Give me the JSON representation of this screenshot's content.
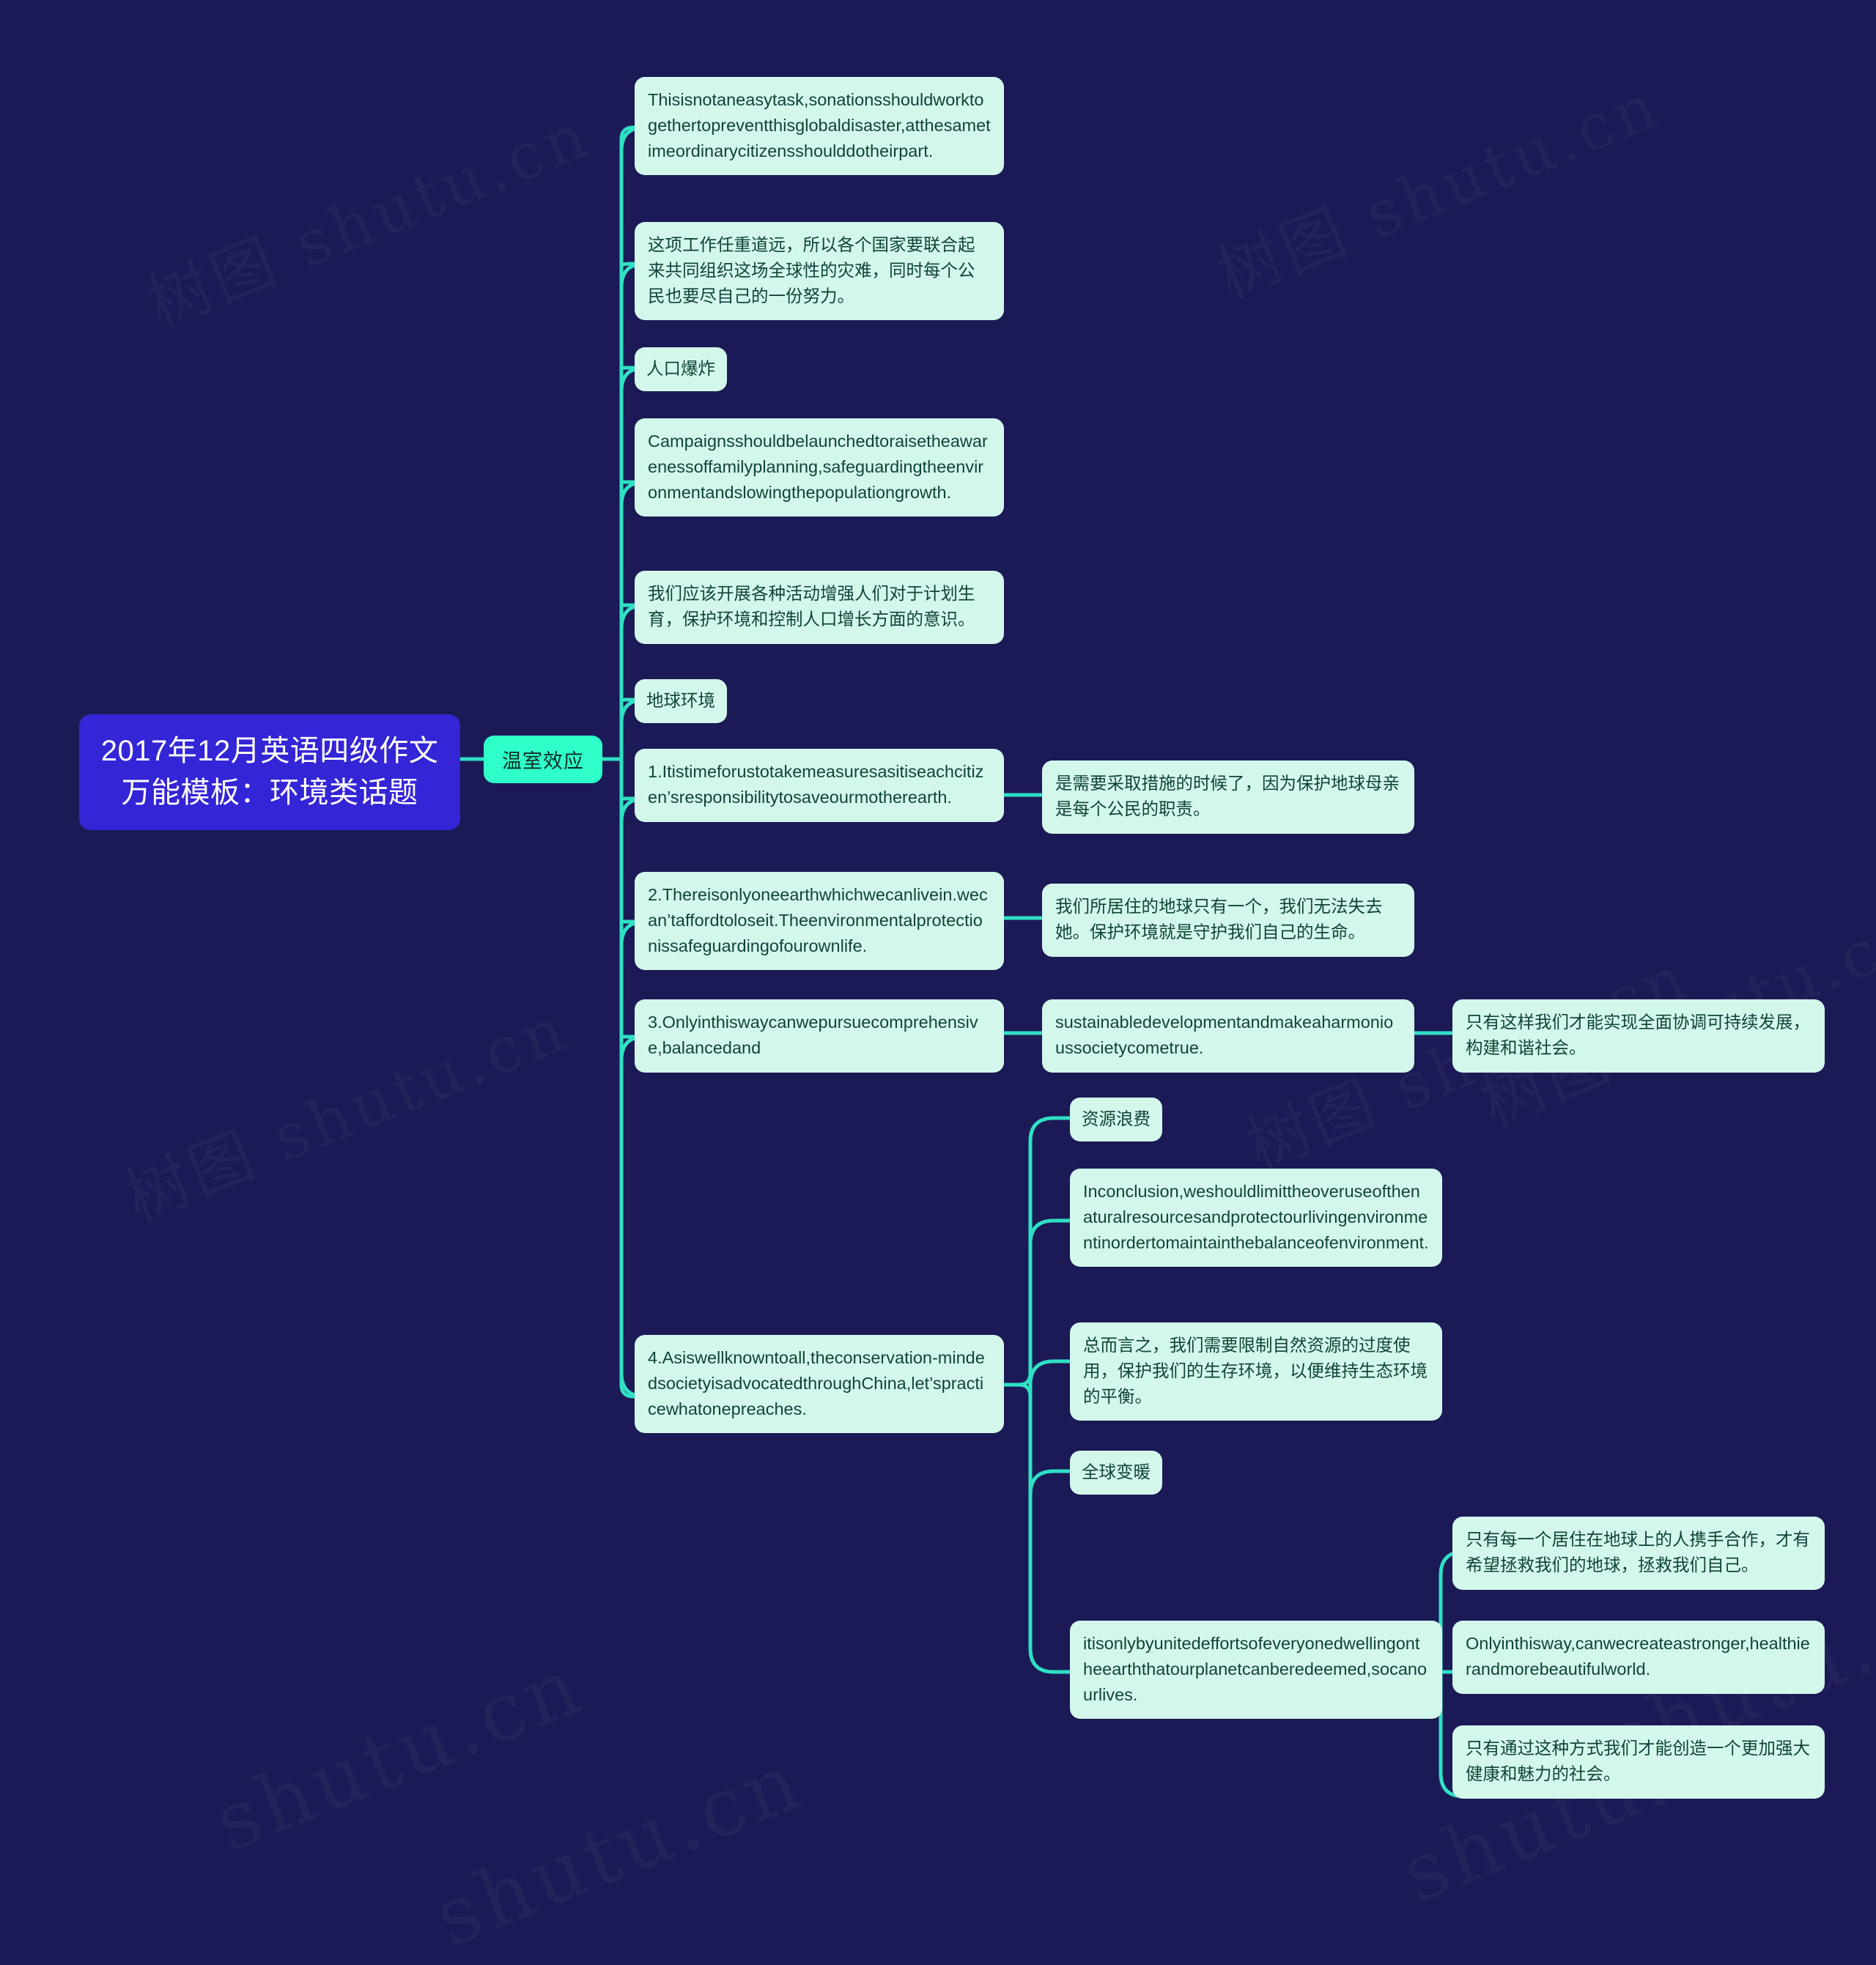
{
  "meta": {
    "background_color": "#1b1a56",
    "root_color": "#3425d6",
    "branch_color": "#2fffc8",
    "node_color": "#d4f7ec",
    "link_color": "#2fe0c4",
    "text_color": "#10443a"
  },
  "watermark": {
    "text": "树图 shutu.cn",
    "text_alt": "shutu.cn"
  },
  "root": {
    "label": "2017年12月英语四级作文万能模板：环境类话题"
  },
  "branch": {
    "label": "温室效应"
  },
  "nodes": {
    "n1": "Thisisnotaneasytask,sonationsshouldworktogethertopreventthisglobaldisaster,atthesametimeordinarycitizensshoulddotheirpart.",
    "n2": "这项工作任重道远，所以各个国家要联合起来共同组织这场全球性的灾难，同时每个公民也要尽自己的一份努力。",
    "n3": "人口爆炸",
    "n4": "Campaignsshouldbelaunchedtoraisetheawarenessoffamilyplanning,safeguardingtheenvironmentandslowingthepopulationgrowth.",
    "n5": "我们应该开展各种活动增强人们对于计划生育，保护环境和控制人口增长方面的意识。",
    "n6": "地球环境",
    "n7": "1.Itistimeforustotakemeasuresasitiseachcitizen’sresponsibilitytosaveourmotherearth.",
    "n7b": "是需要采取措施的时候了，因为保护地球母亲是每个公民的职责。",
    "n8": "2.Thereisonlyoneearthwhichwecanlivein.wecan’taffordtoloseit.Theenvironmentalprotectionissafeguardingofourownlife.",
    "n8b": "我们所居住的地球只有一个，我们无法失去她。保护环境就是守护我们自己的生命。",
    "n9": "3.Onlyinthiswaycanwepursuecomprehensive,balancedand",
    "n9b": "sustainabledevelopmentandmakeaharmonioussocietycometrue.",
    "n9c": "只有这样我们才能实现全面协调可持续发展，构建和谐社会。",
    "n10": "4.Asiswellknowntoall,theconservation-mindedsocietyisadvocatedthroughChina,let’spracticewhatonepreaches.",
    "n10a": "资源浪费",
    "n10b": "Inconclusion,weshouldlimittheoveruseofthenaturalresourcesandprotectourlivingenvironmentinordertomaintainthebalanceofenvironment.",
    "n10c": "总而言之，我们需要限制自然资源的过度使用，保护我们的生存环境，以便维持生态环境的平衡。",
    "n10d": "全球变暖",
    "n10e": "itisonlybyunitedeffortsofeveryonedwellingontheearththatourplanetcanberedeemed,socanourlives.",
    "n10e1": "只有每一个居住在地球上的人携手合作，才有希望拯救我们的地球，拯救我们自己。",
    "n10e2": "Onlyinthisway,canwecreateastronger,healthierandmorebeautifulworld.",
    "n10e3": "只有通过这种方式我们才能创造一个更加强大健康和魅力的社会。"
  }
}
